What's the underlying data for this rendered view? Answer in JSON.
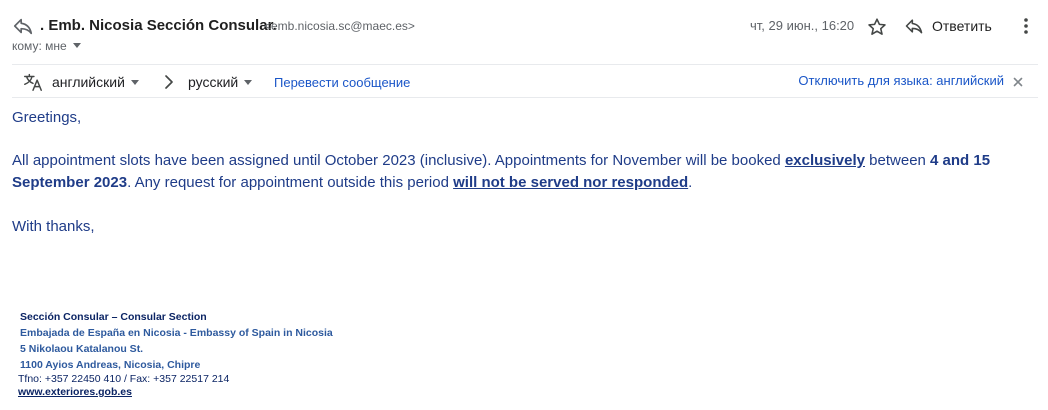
{
  "header": {
    "sender_name": ". Emb. Nicosia Sección Consular.",
    "sender_email": "<emb.nicosia.sc@maec.es>",
    "to_line": "кому: мне",
    "date": "чт, 29 июн., 16:20",
    "reply_label": "Ответить"
  },
  "translate_bar": {
    "from_lang": "английский",
    "to_lang": "русский",
    "translate_link": "Перевести сообщение",
    "disable_link": "Отключить для языка: английский"
  },
  "body": {
    "greeting": "Greetings,",
    "p1_a": "All appointment slots have been assigned until October 2023 (inclusive). Appointments for November will be booked ",
    "p1_b": "exclusively",
    "p1_c": " between ",
    "p1_d": "4 and 15 September 2023",
    "p1_e": ". Any request for appointment outside this period ",
    "p1_f": "will not be served nor responded",
    "p1_g": ".",
    "thanks": "With thanks,"
  },
  "signature": {
    "line1": "Sección Consular – Consular Section",
    "line2": "Embajada de España en Nicosia - Embassy of Spain in Nicosia",
    "line3": "5 Nikolaou Katalanou St.",
    "line4": "1100 Ayios Andreas, Nicosia, Chipre",
    "line5": "Tfno: +357 22450 410 / Fax: +357 22517 214",
    "line6": "www.exteriores.gob.es"
  },
  "colors": {
    "body_text": "#1f3c88",
    "link": "#1a56c8"
  },
  "icons": [
    "reply-arrow-icon",
    "star-icon",
    "reply-icon",
    "more-vert-icon",
    "translate-icon",
    "chevron-right-icon",
    "close-icon"
  ]
}
